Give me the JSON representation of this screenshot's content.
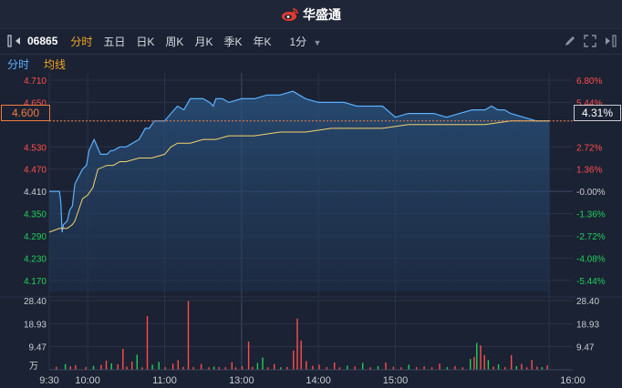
{
  "app": {
    "brand": "华盛通"
  },
  "toolbar": {
    "stock_code": "06865",
    "tabs": [
      "分时",
      "五日",
      "日K",
      "周K",
      "月K",
      "季K",
      "年K"
    ],
    "active_tab": "分时",
    "interval": "1分"
  },
  "subtabs": {
    "time_share": "分时",
    "avg_line": "均线"
  },
  "current": {
    "price": "4.600",
    "pct": "4.31%"
  },
  "colors": {
    "price_line": "#5ab0ff",
    "avg_line": "#f5d36b",
    "up": "#ff4d4d",
    "down": "#1fcf5b",
    "flat": "#c8ccd4",
    "bg": "#1b2233"
  },
  "chart_data": {
    "type": "line",
    "price_axis": {
      "labels": [
        "4.710",
        "4.650",
        "4.600",
        "4.530",
        "4.470",
        "4.410",
        "4.350",
        "4.290",
        "4.230",
        "4.170"
      ],
      "ylim": [
        4.14,
        4.71
      ],
      "prev_close": 4.41
    },
    "pct_axis": {
      "labels": [
        "6.80%",
        "5.44%",
        "4.31%",
        "2.72%",
        "1.36%",
        "-0.00%",
        "-1.36%",
        "-2.72%",
        "-4.08%",
        "-5.44%"
      ]
    },
    "time_labels": [
      "9:30",
      "10:00",
      "11:00",
      "13:00",
      "14:00",
      "15:00",
      "16:00"
    ],
    "price_series": {
      "x": [
        0,
        8,
        9,
        10,
        11,
        14,
        16,
        18,
        20,
        23,
        26,
        29,
        31,
        35,
        40,
        45,
        48,
        50,
        55,
        60,
        65,
        70,
        75,
        78,
        82,
        90,
        95,
        100,
        105,
        110,
        115,
        120,
        125,
        128,
        130,
        135,
        140,
        150,
        160,
        170,
        180,
        190,
        200,
        210,
        220,
        230,
        240,
        250,
        260,
        270,
        280,
        290,
        300,
        310,
        320,
        330,
        335,
        340,
        345,
        350,
        355,
        360,
        370,
        380,
        390
      ],
      "y": [
        4.41,
        4.41,
        4.38,
        4.3,
        4.32,
        4.33,
        4.36,
        4.37,
        4.43,
        4.45,
        4.47,
        4.48,
        4.52,
        4.55,
        4.51,
        4.51,
        4.52,
        4.52,
        4.53,
        4.53,
        4.54,
        4.55,
        4.58,
        4.58,
        4.6,
        4.6,
        4.62,
        4.64,
        4.63,
        4.66,
        4.66,
        4.66,
        4.65,
        4.64,
        4.66,
        4.66,
        4.65,
        4.66,
        4.66,
        4.67,
        4.67,
        4.68,
        4.66,
        4.65,
        4.65,
        4.65,
        4.64,
        4.64,
        4.64,
        4.61,
        4.62,
        4.62,
        4.62,
        4.61,
        4.62,
        4.63,
        4.63,
        4.63,
        4.64,
        4.63,
        4.63,
        4.62,
        4.61,
        4.6,
        4.6
      ]
    },
    "avg_series": {
      "x": [
        0,
        8,
        10,
        14,
        18,
        20,
        22,
        26,
        30,
        34,
        38,
        45,
        50,
        55,
        60,
        70,
        80,
        90,
        95,
        100,
        110,
        120,
        130,
        140,
        160,
        180,
        200,
        220,
        240,
        260,
        280,
        300,
        320,
        340,
        360,
        380,
        390
      ],
      "y": [
        4.3,
        4.31,
        4.31,
        4.31,
        4.32,
        4.33,
        4.35,
        4.39,
        4.4,
        4.42,
        4.47,
        4.48,
        4.48,
        4.49,
        4.49,
        4.5,
        4.5,
        4.51,
        4.53,
        4.54,
        4.54,
        4.55,
        4.55,
        4.56,
        4.56,
        4.57,
        4.57,
        4.58,
        4.58,
        4.58,
        4.59,
        4.59,
        4.59,
        4.59,
        4.6,
        4.6,
        4.6
      ]
    },
    "volume_axis": {
      "labels": [
        "28.40",
        "18.93",
        "9.47",
        "万"
      ],
      "ylim": [
        0,
        28.4
      ]
    },
    "volume_bars": [
      {
        "x": 5,
        "v": 1.2,
        "d": "up"
      },
      {
        "x": 12,
        "v": 2.3,
        "d": "down"
      },
      {
        "x": 16,
        "v": 1.4,
        "d": "up"
      },
      {
        "x": 20,
        "v": 1.9,
        "d": "up"
      },
      {
        "x": 28,
        "v": 1.1,
        "d": "up"
      },
      {
        "x": 34,
        "v": 1.6,
        "d": "down"
      },
      {
        "x": 40,
        "v": 2.0,
        "d": "up"
      },
      {
        "x": 44,
        "v": 3.8,
        "d": "up"
      },
      {
        "x": 48,
        "v": 2.6,
        "d": "down"
      },
      {
        "x": 53,
        "v": 2.2,
        "d": "up"
      },
      {
        "x": 57,
        "v": 8.6,
        "d": "up"
      },
      {
        "x": 60,
        "v": 1.3,
        "d": "up"
      },
      {
        "x": 64,
        "v": 3.4,
        "d": "up"
      },
      {
        "x": 68,
        "v": 6.2,
        "d": "down"
      },
      {
        "x": 72,
        "v": 1.0,
        "d": "up"
      },
      {
        "x": 76,
        "v": 22.0,
        "d": "up"
      },
      {
        "x": 80,
        "v": 2.1,
        "d": "down"
      },
      {
        "x": 85,
        "v": 3.2,
        "d": "down"
      },
      {
        "x": 90,
        "v": 1.0,
        "d": "up"
      },
      {
        "x": 96,
        "v": 2.5,
        "d": "up"
      },
      {
        "x": 100,
        "v": 4.0,
        "d": "up"
      },
      {
        "x": 104,
        "v": 1.2,
        "d": "up"
      },
      {
        "x": 108,
        "v": 28.2,
        "d": "up"
      },
      {
        "x": 112,
        "v": 1.1,
        "d": "up"
      },
      {
        "x": 118,
        "v": 2.4,
        "d": "up"
      },
      {
        "x": 124,
        "v": 1.0,
        "d": "up"
      },
      {
        "x": 128,
        "v": 1.3,
        "d": "down"
      },
      {
        "x": 132,
        "v": 1.1,
        "d": "up"
      },
      {
        "x": 137,
        "v": 1.1,
        "d": "up"
      },
      {
        "x": 142,
        "v": 3.1,
        "d": "up"
      },
      {
        "x": 145,
        "v": 1.0,
        "d": "up"
      },
      {
        "x": 150,
        "v": 1.5,
        "d": "up"
      },
      {
        "x": 155,
        "v": 11.6,
        "d": "up"
      },
      {
        "x": 158,
        "v": 1.2,
        "d": "up"
      },
      {
        "x": 162,
        "v": 2.8,
        "d": "down"
      },
      {
        "x": 166,
        "v": 5.0,
        "d": "down"
      },
      {
        "x": 170,
        "v": 1.0,
        "d": "up"
      },
      {
        "x": 175,
        "v": 2.3,
        "d": "up"
      },
      {
        "x": 180,
        "v": 1.0,
        "d": "down"
      },
      {
        "x": 185,
        "v": 1.2,
        "d": "up"
      },
      {
        "x": 190,
        "v": 7.9,
        "d": "up"
      },
      {
        "x": 193,
        "v": 21.0,
        "d": "up"
      },
      {
        "x": 196,
        "v": 12.0,
        "d": "up"
      },
      {
        "x": 200,
        "v": 3.6,
        "d": "up"
      },
      {
        "x": 205,
        "v": 1.6,
        "d": "up"
      },
      {
        "x": 210,
        "v": 2.1,
        "d": "up"
      },
      {
        "x": 216,
        "v": 1.1,
        "d": "up"
      },
      {
        "x": 222,
        "v": 3.0,
        "d": "up"
      },
      {
        "x": 226,
        "v": 1.0,
        "d": "up"
      },
      {
        "x": 232,
        "v": 1.7,
        "d": "down"
      },
      {
        "x": 238,
        "v": 1.4,
        "d": "up"
      },
      {
        "x": 244,
        "v": 2.8,
        "d": "down"
      },
      {
        "x": 250,
        "v": 1.0,
        "d": "up"
      },
      {
        "x": 256,
        "v": 1.5,
        "d": "down"
      },
      {
        "x": 262,
        "v": 3.0,
        "d": "up"
      },
      {
        "x": 268,
        "v": 1.2,
        "d": "up"
      },
      {
        "x": 274,
        "v": 1.0,
        "d": "up"
      },
      {
        "x": 280,
        "v": 2.1,
        "d": "down"
      },
      {
        "x": 286,
        "v": 1.1,
        "d": "up"
      },
      {
        "x": 292,
        "v": 1.4,
        "d": "up"
      },
      {
        "x": 298,
        "v": 1.0,
        "d": "up"
      },
      {
        "x": 304,
        "v": 2.5,
        "d": "up"
      },
      {
        "x": 310,
        "v": 1.1,
        "d": "down"
      },
      {
        "x": 316,
        "v": 1.5,
        "d": "up"
      },
      {
        "x": 322,
        "v": 1.0,
        "d": "up"
      },
      {
        "x": 328,
        "v": 4.4,
        "d": "down"
      },
      {
        "x": 331,
        "v": 5.3,
        "d": "up"
      },
      {
        "x": 333,
        "v": 11.0,
        "d": "down"
      },
      {
        "x": 336,
        "v": 10.0,
        "d": "up"
      },
      {
        "x": 339,
        "v": 6.0,
        "d": "up"
      },
      {
        "x": 342,
        "v": 4.0,
        "d": "down"
      },
      {
        "x": 346,
        "v": 1.3,
        "d": "up"
      },
      {
        "x": 350,
        "v": 2.2,
        "d": "down"
      },
      {
        "x": 355,
        "v": 1.1,
        "d": "up"
      },
      {
        "x": 360,
        "v": 6.0,
        "d": "up"
      },
      {
        "x": 364,
        "v": 1.5,
        "d": "down"
      },
      {
        "x": 368,
        "v": 2.4,
        "d": "up"
      },
      {
        "x": 372,
        "v": 1.0,
        "d": "up"
      },
      {
        "x": 376,
        "v": 4.0,
        "d": "up"
      },
      {
        "x": 380,
        "v": 1.3,
        "d": "up"
      },
      {
        "x": 384,
        "v": 1.1,
        "d": "down"
      },
      {
        "x": 388,
        "v": 1.8,
        "d": "up"
      }
    ]
  }
}
